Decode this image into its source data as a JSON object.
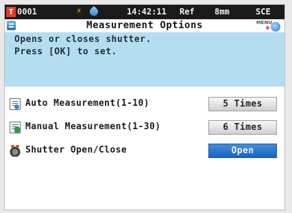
{
  "status_bar": {
    "badge": "T",
    "id": "0001",
    "flash_icon": "lightning-icon",
    "drop_icon": "drop-icon",
    "time": "14:42:11",
    "ref": "Ref",
    "aperture": "8mm",
    "mode": "SCE"
  },
  "title_bar": {
    "icon": "settings-list-icon",
    "title": "Measurement Options",
    "menu_label": "MENU",
    "back_icon": "return-arrow-icon"
  },
  "help": {
    "line1": "Opens or closes shutter.",
    "line2": "Press [OK] to set."
  },
  "options": [
    {
      "icon": "auto-measurement-icon",
      "label": "Auto Measurement(1-10)",
      "value": "5 Times",
      "selected": false
    },
    {
      "icon": "manual-measurement-icon",
      "label": "Manual Measurement(1-30)",
      "value": "6 Times",
      "selected": false
    },
    {
      "icon": "shutter-icon",
      "label": "Shutter Open/Close",
      "value": "Open",
      "selected": true
    }
  ],
  "colors": {
    "status_bg": "#1a1a1a",
    "help_bg": "#b4ddf2",
    "selected_button": "#2a74d0",
    "badge_red": "#e23b2e"
  }
}
